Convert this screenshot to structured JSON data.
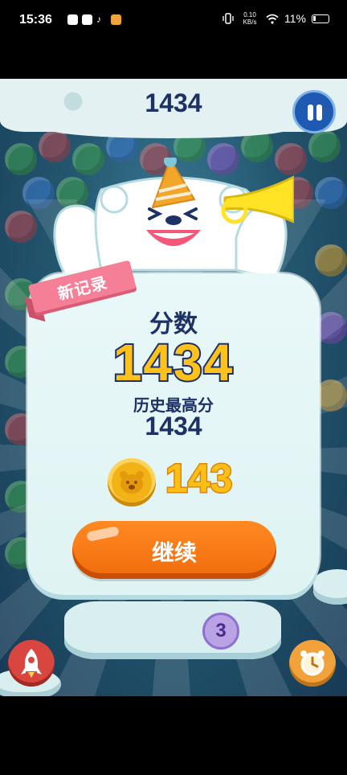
{
  "status_bar": {
    "time": "15:36",
    "net_speed": "0.10 KB/s",
    "battery": "11%",
    "icons_left": [
      "app-icon",
      "mail-icon",
      "tiktok-icon",
      "weibo-icon"
    ],
    "icons_right": [
      "vibrate-icon",
      "speed-readout",
      "wifi-icon",
      "battery-icon"
    ]
  },
  "game": {
    "top_score": "1434",
    "pause_icon": "pause-icon",
    "bubble_counter": "3"
  },
  "result": {
    "new_record_label": "新记录",
    "score_label": "分数",
    "score": "1434",
    "best_label": "历史最高分",
    "best_score": "1434",
    "coins": "143",
    "continue_label": "继续"
  },
  "colors": {
    "navy": "#1d3166",
    "gold": "#ffc21d",
    "orange_button": "#f06b0c",
    "ribbon_pink": "#f57f97",
    "card": "#e9f8f9"
  }
}
